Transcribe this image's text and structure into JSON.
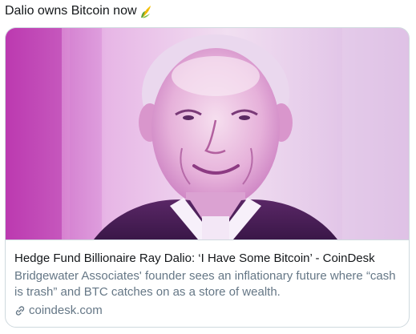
{
  "tweet": {
    "text": "Dalio owns Bitcoin now",
    "emoji": "corn-emoji"
  },
  "card": {
    "image_alt": "Ray Dalio portrait, pink-tinted",
    "title": "Hedge Fund Billionaire Ray Dalio: ‘I Have Some Bitcoin’ - CoinDesk",
    "description": "Bridgewater Associates' founder sees an inflationary future where “cash is trash” and BTC catches on as a store of wealth.",
    "domain": "coindesk.com",
    "link_icon": "link-icon"
  },
  "colors": {
    "text_primary": "#14171a",
    "text_secondary": "#657786",
    "border": "#cfd9de",
    "image_tint": "#c03ab8"
  }
}
